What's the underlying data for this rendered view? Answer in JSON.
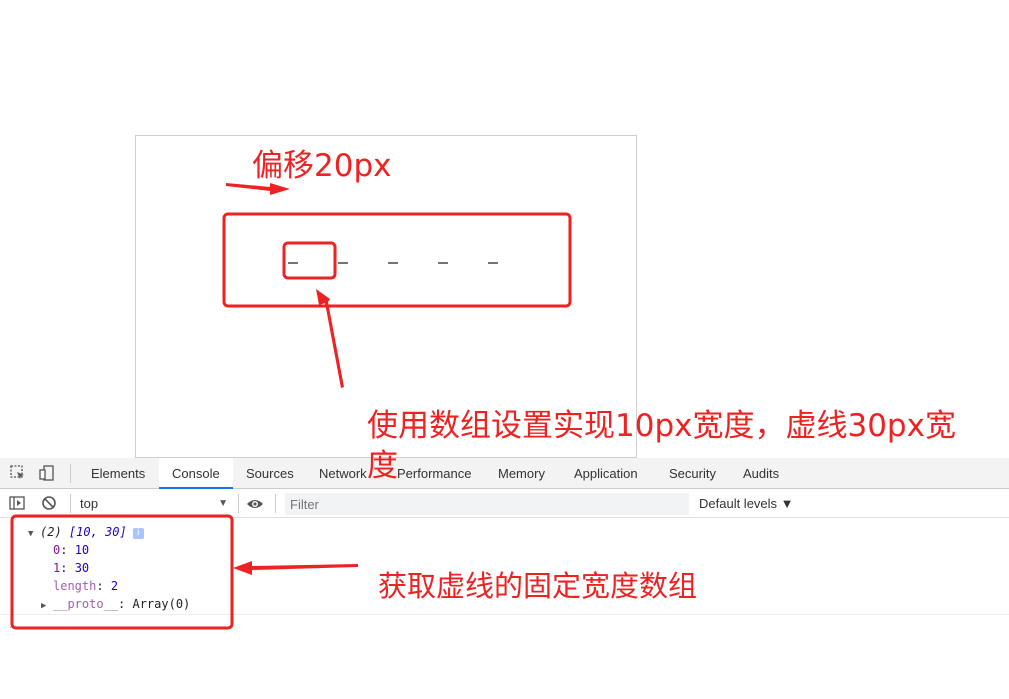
{
  "annotations": {
    "offset_label": "偏移20px",
    "array_setting_label_line1": "使用数组设置实现10px宽度，虚线30px宽",
    "array_setting_label_line2": "度",
    "get_array_label": "获取虚线的固定宽度数组"
  },
  "devtools": {
    "tabs": [
      "Elements",
      "Console",
      "Sources",
      "Network",
      "Performance",
      "Memory",
      "Application",
      "Security",
      "Audits"
    ],
    "active_tab": "Console",
    "context": "top",
    "filter_placeholder": "Filter",
    "levels_label": "Default levels ▼"
  },
  "console": {
    "summary_count": "(2)",
    "summary_array": "[10, 30]",
    "entries": [
      {
        "key": "0",
        "value": "10"
      },
      {
        "key": "1",
        "value": "30"
      },
      {
        "key": "length",
        "value": "2"
      }
    ],
    "proto_key": "__proto__",
    "proto_value": "Array(0)",
    "info_badge": "i"
  },
  "colors": {
    "annotation_red": "#ee2222",
    "active_tab_underline": "#1a73e8"
  }
}
